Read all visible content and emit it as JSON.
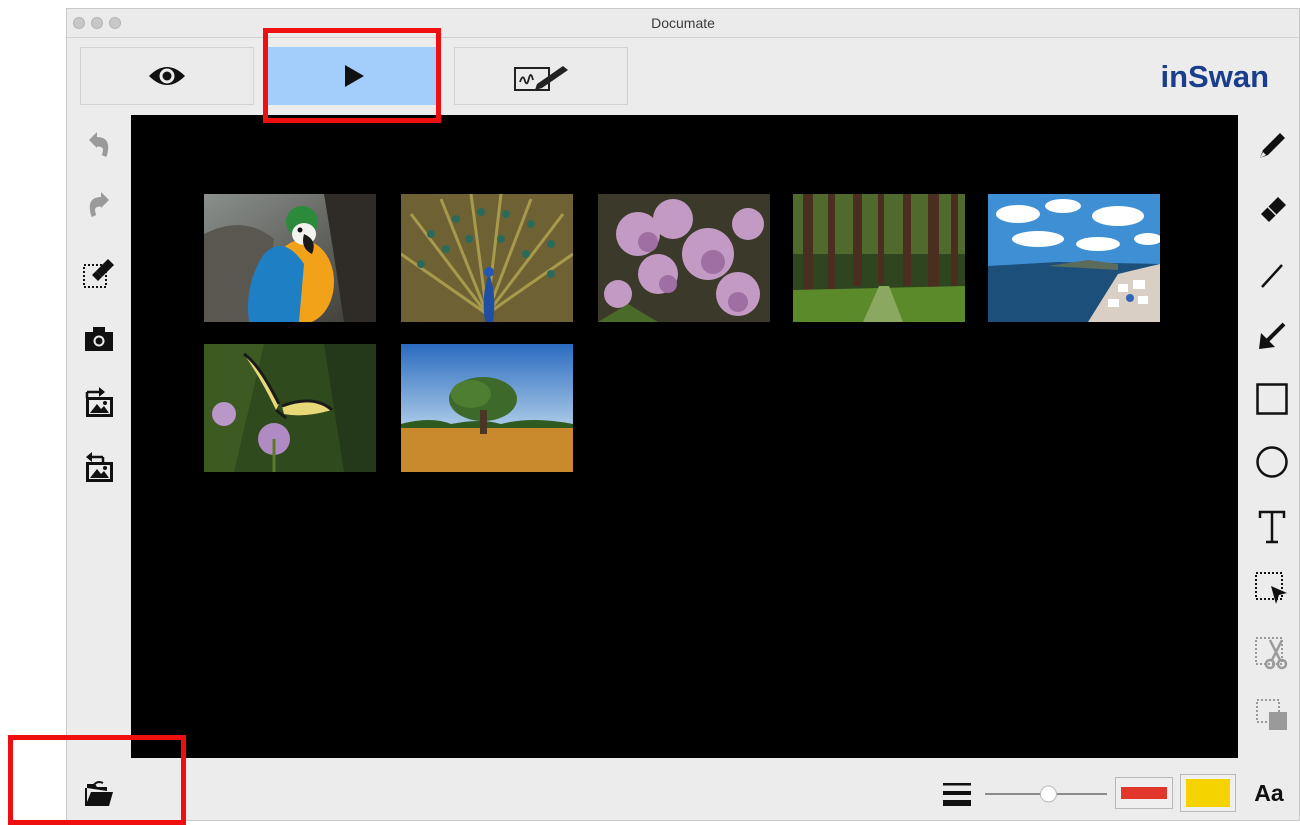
{
  "window": {
    "title": "Documate"
  },
  "brand": {
    "logo_text": "inSwan",
    "logo_color": "#1a3e8c"
  },
  "modes": [
    {
      "name": "view",
      "icon": "eye-icon",
      "active": false
    },
    {
      "name": "present",
      "icon": "play-icon",
      "active": true
    },
    {
      "name": "annotate",
      "icon": "signature-pen-icon",
      "active": false
    }
  ],
  "left_tools": [
    "undo-icon",
    "redo-icon",
    "erase-selection-icon",
    "camera-icon",
    "import-image-icon",
    "export-image-icon"
  ],
  "right_tools": [
    "pencil-icon",
    "eraser-icon",
    "line-icon",
    "arrow-icon",
    "rectangle-icon",
    "circle-icon",
    "text-icon",
    "select-icon",
    "cut-icon",
    "paste-icon"
  ],
  "thumbnails": [
    "parrot",
    "peacock",
    "lilac-flowers",
    "forest",
    "coastal-town",
    "butterfly",
    "tree-field"
  ],
  "bottom": {
    "open_icon": "folder-open-icon",
    "line_width_icon": "line-width-icon",
    "slider_level": 0.52,
    "stroke_color": "#e0362c",
    "fill_color": "#f5d300",
    "font_label": "Aa"
  },
  "colors": {
    "active_mode_bg": "#a3cdfa",
    "highlight": "#ee1010",
    "canvas_bg": "#000000"
  }
}
